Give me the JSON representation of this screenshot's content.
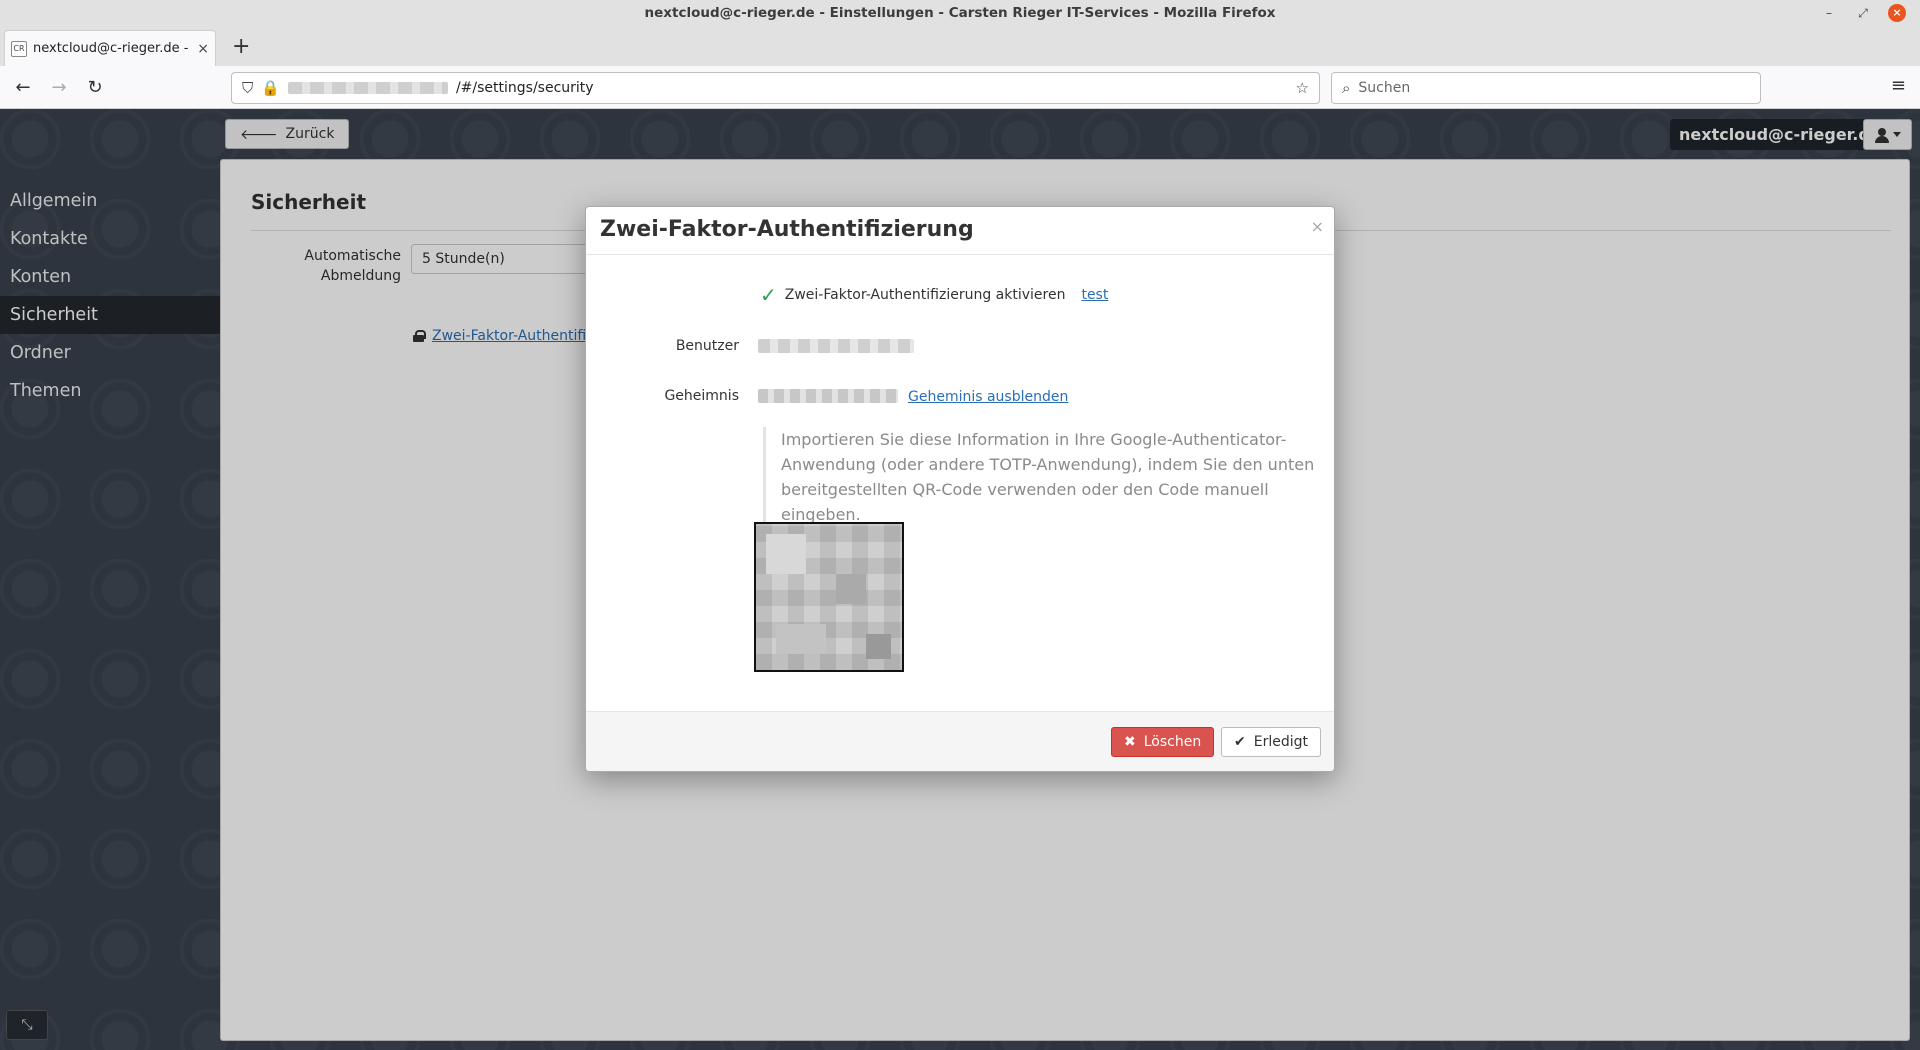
{
  "browser": {
    "window_title": "nextcloud@c-rieger.de - Einstellungen - Carsten Rieger IT-Services - Mozilla Firefox",
    "tab": {
      "favicon_text": "CR",
      "title": "nextcloud@c-rieger.de - Einstellungen",
      "close": "×"
    },
    "new_tab": "+",
    "url_path": "/#/settings/security",
    "search_placeholder": "Suchen",
    "icons": {
      "back": "←",
      "forward": "→",
      "reload": "↻",
      "shield": "⛉",
      "lock": "🔒",
      "star": "☆",
      "search": "⌕",
      "menu": "≡",
      "minimize": "–",
      "maximize": "⤢",
      "close": "×"
    }
  },
  "header": {
    "back_label": "Zurück",
    "back_icon": "🡐",
    "account_email": "nextcloud@c-rieger.de"
  },
  "sidebar": {
    "items": [
      {
        "label": "Allgemein"
      },
      {
        "label": "Kontakte"
      },
      {
        "label": "Konten"
      },
      {
        "label": "Sicherheit",
        "active": true
      },
      {
        "label": "Ordner"
      },
      {
        "label": "Themen"
      }
    ],
    "collapse_icon": "⤡"
  },
  "page": {
    "title": "Sicherheit",
    "auto_logout_label": "Automatische Abmeldung",
    "auto_logout_value": "5 Stunde(n)",
    "twofa_link": "Zwei-Faktor-Authentifizierung"
  },
  "modal": {
    "title": "Zwei-Faktor-Authentifizierung",
    "close": "×",
    "activate_check": "✓",
    "activate_label": "Zwei-Faktor-Authentifizierung aktivieren",
    "activate_link": "test",
    "user_label": "Benutzer",
    "secret_label": "Geheimnis",
    "secret_toggle": "Geheminis ausblenden",
    "hint": "Importieren Sie diese Information in Ihre Google-Authenticator-Anwendung (oder andere TOTP-Anwendung), indem Sie den unten bereitgestellten QR-Code verwenden oder den Code manuell eingeben.",
    "delete_icon": "✖",
    "delete_label": "Löschen",
    "done_icon": "✔",
    "done_label": "Erledigt"
  },
  "colors": {
    "app_bg": "#39424d",
    "danger": "#d9534f",
    "success": "#2e9d55",
    "link": "#2a6fb5"
  }
}
